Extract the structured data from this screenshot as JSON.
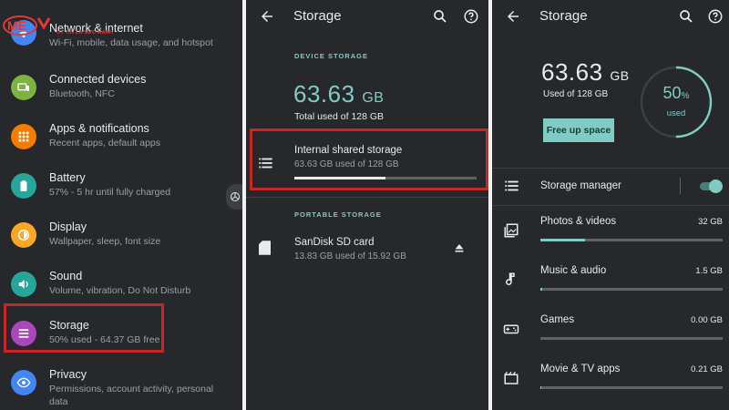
{
  "colors": {
    "bg": "#26282b",
    "accent": "#80cbc4",
    "highlight": "#c62828"
  },
  "logo": {
    "text": "ME",
    "tagline": "UY TÍN LÀ SỨC MẠNH"
  },
  "settings": {
    "items": [
      {
        "title": "Network & internet",
        "sub": "Wi-Fi, mobile, data usage, and hotspot",
        "color": "#4285f4",
        "icon": "wifi-icon"
      },
      {
        "title": "Connected devices",
        "sub": "Bluetooth, NFC",
        "color": "#7cb342",
        "icon": "devices-icon"
      },
      {
        "title": "Apps & notifications",
        "sub": "Recent apps, default apps",
        "color": "#f57c00",
        "icon": "apps-icon"
      },
      {
        "title": "Battery",
        "sub": "57% - 5 hr until fully charged",
        "color": "#26a69a",
        "icon": "battery-icon"
      },
      {
        "title": "Display",
        "sub": "Wallpaper, sleep, font size",
        "color": "#f9a825",
        "icon": "brightness-icon"
      },
      {
        "title": "Sound",
        "sub": "Volume, vibration, Do Not Disturb",
        "color": "#26a69a",
        "icon": "volume-icon"
      },
      {
        "title": "Storage",
        "sub": "50% used - 64.37 GB free",
        "color": "#ab47bc",
        "icon": "storage-icon"
      },
      {
        "title": "Privacy",
        "sub": "Permissions, account activity, personal",
        "sub2": "data",
        "color": "#4285f4",
        "icon": "privacy-eye-icon"
      }
    ]
  },
  "storage_overview": {
    "title": "Storage",
    "device_label": "DEVICE STORAGE",
    "used_value": "63.63",
    "used_unit": "GB",
    "total_text": "Total used of 128 GB",
    "internal": {
      "title": "Internal shared storage",
      "sub": "63.63 GB used of 128 GB",
      "fraction": 0.5
    },
    "portable_label": "PORTABLE STORAGE",
    "sdcard": {
      "title": "SanDisk SD card",
      "sub": "13.83 GB used of 15.92 GB"
    }
  },
  "storage_detail": {
    "title": "Storage",
    "used_value": "63.63",
    "used_unit": "GB",
    "used_of": "Used of 128 GB",
    "percent": "50",
    "percent_sign": "%",
    "percent_label": "used",
    "percent_fraction": 0.5,
    "free_button": "Free up space",
    "manager_label": "Storage manager",
    "manager_on": true,
    "categories": [
      {
        "title": "Photos & videos",
        "value": "32 GB",
        "fraction": 0.245,
        "icon": "photos-icon"
      },
      {
        "title": "Music & audio",
        "value": "1.5 GB",
        "fraction": 0.012,
        "icon": "music-note-icon"
      },
      {
        "title": "Games",
        "value": "0.00 GB",
        "fraction": 0.0,
        "icon": "gamepad-icon"
      },
      {
        "title": "Movie & TV apps",
        "value": "0.21 GB",
        "fraction": 0.005,
        "icon": "movie-icon"
      }
    ]
  }
}
